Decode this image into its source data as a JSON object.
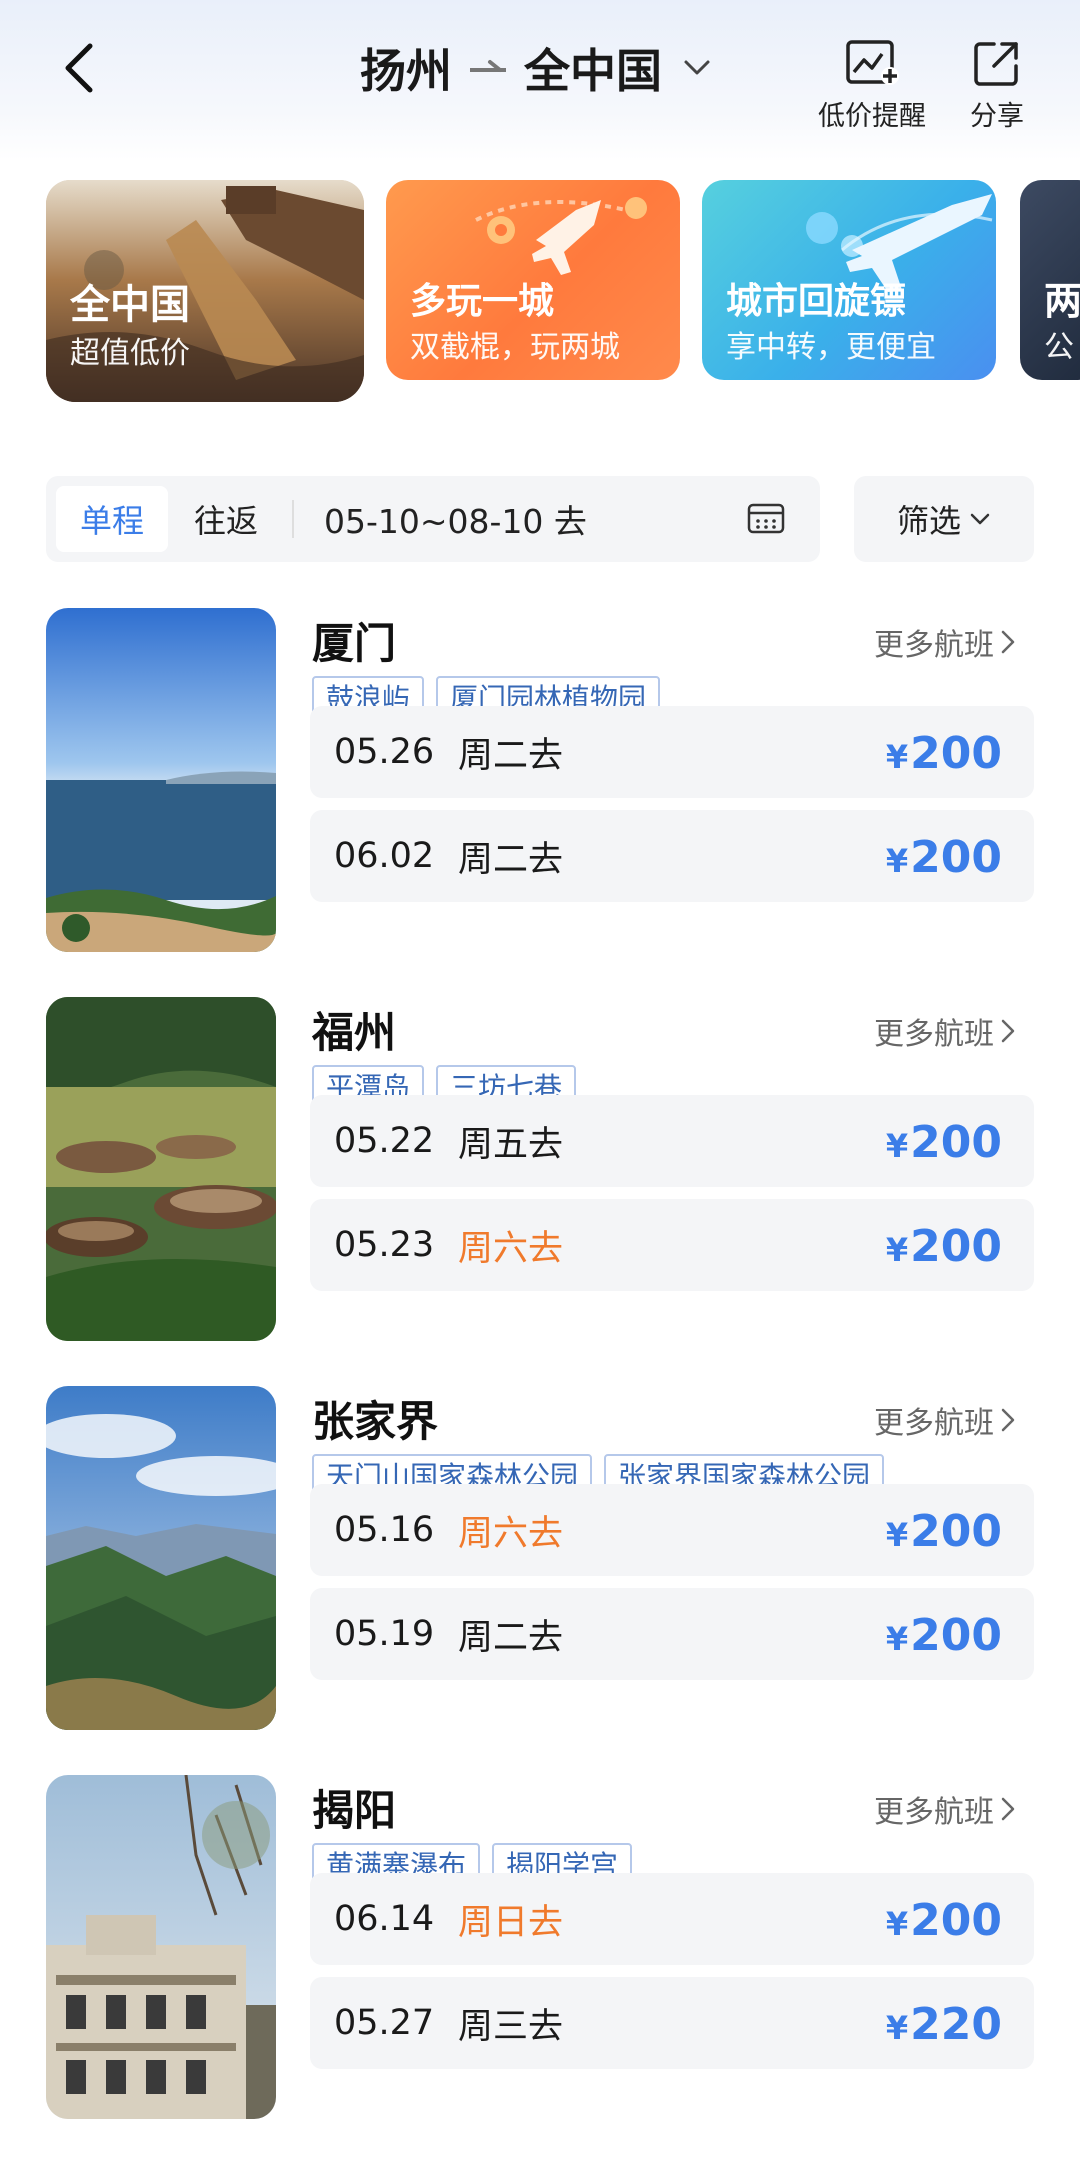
{
  "header": {
    "origin": "扬州",
    "destination": "全中国",
    "alert_label": "低价提醒",
    "share_label": "分享"
  },
  "banners": [
    {
      "title": "全中国",
      "subtitle": "超值低价"
    },
    {
      "title": "多玩一城",
      "subtitle": "双截棍，玩两城"
    },
    {
      "title": "城市回旋镖",
      "subtitle": "享中转，更便宜"
    },
    {
      "title": "两",
      "subtitle": "公"
    }
  ],
  "filter": {
    "tab_single": "单程",
    "tab_return": "往返",
    "date_range": "05-10~08-10 去",
    "screen_label": "筛选"
  },
  "more_flights_label": "更多航班",
  "currency_symbol": "¥",
  "destinations": [
    {
      "name": "厦门",
      "tags": [
        "鼓浪屿",
        "厦门园林植物园"
      ],
      "flights": [
        {
          "date": "05.26",
          "day": "周二去",
          "price": "200"
        },
        {
          "date": "06.02",
          "day": "周二去",
          "price": "200"
        }
      ]
    },
    {
      "name": "福州",
      "tags": [
        "平潭岛",
        "三坊七巷"
      ],
      "flights": [
        {
          "date": "05.22",
          "day": "周五去",
          "price": "200"
        },
        {
          "date": "05.23",
          "day": "周六去",
          "price": "200"
        }
      ]
    },
    {
      "name": "张家界",
      "tags": [
        "天门山国家森林公园",
        "张家界国家森林公园"
      ],
      "flights": [
        {
          "date": "05.16",
          "day": "周六去",
          "price": "200"
        },
        {
          "date": "05.19",
          "day": "周二去",
          "price": "200"
        }
      ]
    },
    {
      "name": "揭阳",
      "tags": [
        "黄满寨瀑布",
        "揭阳学宫"
      ],
      "flights": [
        {
          "date": "06.14",
          "day": "周日去",
          "price": "200"
        },
        {
          "date": "05.27",
          "day": "周三去",
          "price": "220"
        }
      ]
    }
  ],
  "colors": {
    "accent_blue": "#3b7de8",
    "weekend_orange": "#f07a2c",
    "tag_border": "#b5c8ea"
  }
}
